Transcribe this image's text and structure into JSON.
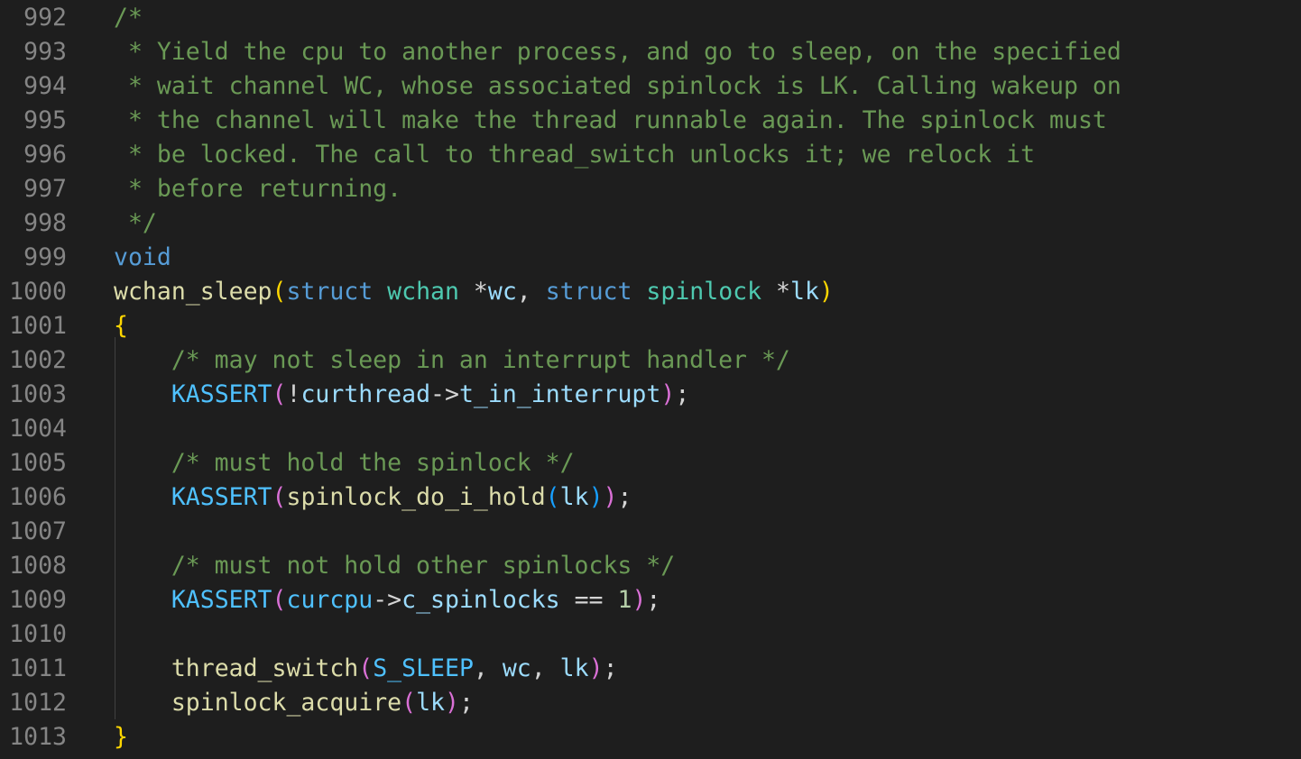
{
  "editor": {
    "colors": {
      "background": "#1e1e1e",
      "line_number": "#858585",
      "comment": "#6a9955",
      "keyword": "#569cd6",
      "type": "#4ec9b0",
      "function": "#dcdcaa",
      "variable": "#9cdcfe",
      "macro": "#4fc1ff",
      "number": "#b5cea8",
      "bracket_gold": "#ffd700",
      "bracket_purple": "#da70d6",
      "bracket_blue": "#179fff",
      "default": "#d4d4d4"
    },
    "lines": [
      {
        "number": "992",
        "tokens": [
          {
            "text": "/*",
            "kind": "comment"
          }
        ]
      },
      {
        "number": "993",
        "tokens": [
          {
            "text": " * Yield the cpu to another process, and go to sleep, on the specified",
            "kind": "comment"
          }
        ]
      },
      {
        "number": "994",
        "tokens": [
          {
            "text": " * wait channel WC, whose associated spinlock is LK. Calling wakeup on",
            "kind": "comment"
          }
        ]
      },
      {
        "number": "995",
        "tokens": [
          {
            "text": " * the channel will make the thread runnable again. The spinlock must",
            "kind": "comment"
          }
        ]
      },
      {
        "number": "996",
        "tokens": [
          {
            "text": " * be locked. The call to thread_switch unlocks it; we relock it",
            "kind": "comment"
          }
        ]
      },
      {
        "number": "997",
        "tokens": [
          {
            "text": " * before returning.",
            "kind": "comment"
          }
        ]
      },
      {
        "number": "998",
        "tokens": [
          {
            "text": " */",
            "kind": "comment"
          }
        ]
      },
      {
        "number": "999",
        "tokens": [
          {
            "text": "void",
            "kind": "keyword"
          }
        ]
      },
      {
        "number": "1000",
        "tokens": [
          {
            "text": "wchan_sleep",
            "kind": "function"
          },
          {
            "text": "(",
            "kind": "bracket_gold"
          },
          {
            "text": "struct",
            "kind": "keyword"
          },
          {
            "text": " ",
            "kind": "default"
          },
          {
            "text": "wchan",
            "kind": "type"
          },
          {
            "text": " *",
            "kind": "default"
          },
          {
            "text": "wc",
            "kind": "variable"
          },
          {
            "text": ", ",
            "kind": "default"
          },
          {
            "text": "struct",
            "kind": "keyword"
          },
          {
            "text": " ",
            "kind": "default"
          },
          {
            "text": "spinlock",
            "kind": "type"
          },
          {
            "text": " *",
            "kind": "default"
          },
          {
            "text": "lk",
            "kind": "variable"
          },
          {
            "text": ")",
            "kind": "bracket_gold"
          }
        ]
      },
      {
        "number": "1001",
        "tokens": [
          {
            "text": "{",
            "kind": "bracket_gold"
          }
        ]
      },
      {
        "number": "1002",
        "tokens": [
          {
            "text": "    /* may not sleep in an interrupt handler */",
            "kind": "comment"
          }
        ]
      },
      {
        "number": "1003",
        "tokens": [
          {
            "text": "    ",
            "kind": "default"
          },
          {
            "text": "KASSERT",
            "kind": "macro"
          },
          {
            "text": "(",
            "kind": "bracket_purple"
          },
          {
            "text": "!",
            "kind": "default"
          },
          {
            "text": "curthread",
            "kind": "variable"
          },
          {
            "text": "->",
            "kind": "default"
          },
          {
            "text": "t_in_interrupt",
            "kind": "variable"
          },
          {
            "text": ")",
            "kind": "bracket_purple"
          },
          {
            "text": ";",
            "kind": "default"
          }
        ]
      },
      {
        "number": "1004",
        "tokens": []
      },
      {
        "number": "1005",
        "tokens": [
          {
            "text": "    /* must hold the spinlock */",
            "kind": "comment"
          }
        ]
      },
      {
        "number": "1006",
        "tokens": [
          {
            "text": "    ",
            "kind": "default"
          },
          {
            "text": "KASSERT",
            "kind": "macro"
          },
          {
            "text": "(",
            "kind": "bracket_purple"
          },
          {
            "text": "spinlock_do_i_hold",
            "kind": "function"
          },
          {
            "text": "(",
            "kind": "bracket_blue"
          },
          {
            "text": "lk",
            "kind": "variable"
          },
          {
            "text": ")",
            "kind": "bracket_blue"
          },
          {
            "text": ")",
            "kind": "bracket_purple"
          },
          {
            "text": ";",
            "kind": "default"
          }
        ]
      },
      {
        "number": "1007",
        "tokens": []
      },
      {
        "number": "1008",
        "tokens": [
          {
            "text": "    /* must not hold other spinlocks */",
            "kind": "comment"
          }
        ]
      },
      {
        "number": "1009",
        "tokens": [
          {
            "text": "    ",
            "kind": "default"
          },
          {
            "text": "KASSERT",
            "kind": "macro"
          },
          {
            "text": "(",
            "kind": "bracket_purple"
          },
          {
            "text": "curcpu",
            "kind": "macro"
          },
          {
            "text": "->",
            "kind": "default"
          },
          {
            "text": "c_spinlocks",
            "kind": "variable"
          },
          {
            "text": " == ",
            "kind": "default"
          },
          {
            "text": "1",
            "kind": "number"
          },
          {
            "text": ")",
            "kind": "bracket_purple"
          },
          {
            "text": ";",
            "kind": "default"
          }
        ]
      },
      {
        "number": "1010",
        "tokens": []
      },
      {
        "number": "1011",
        "tokens": [
          {
            "text": "    ",
            "kind": "default"
          },
          {
            "text": "thread_switch",
            "kind": "function"
          },
          {
            "text": "(",
            "kind": "bracket_purple"
          },
          {
            "text": "S_SLEEP",
            "kind": "macro"
          },
          {
            "text": ", ",
            "kind": "default"
          },
          {
            "text": "wc",
            "kind": "variable"
          },
          {
            "text": ", ",
            "kind": "default"
          },
          {
            "text": "lk",
            "kind": "variable"
          },
          {
            "text": ")",
            "kind": "bracket_purple"
          },
          {
            "text": ";",
            "kind": "default"
          }
        ]
      },
      {
        "number": "1012",
        "tokens": [
          {
            "text": "    ",
            "kind": "default"
          },
          {
            "text": "spinlock_acquire",
            "kind": "function"
          },
          {
            "text": "(",
            "kind": "bracket_purple"
          },
          {
            "text": "lk",
            "kind": "variable"
          },
          {
            "text": ")",
            "kind": "bracket_purple"
          },
          {
            "text": ";",
            "kind": "default"
          }
        ]
      },
      {
        "number": "1013",
        "tokens": [
          {
            "text": "}",
            "kind": "bracket_gold"
          }
        ]
      }
    ]
  }
}
